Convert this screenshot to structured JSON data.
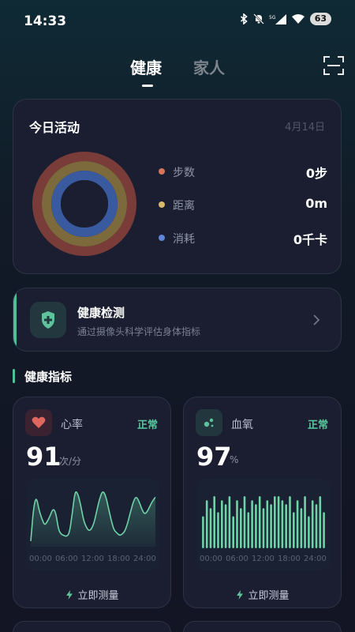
{
  "status_bar": {
    "time": "14:33",
    "battery": "63",
    "network_label": "5G"
  },
  "tabs": [
    {
      "label": "健康",
      "active": true
    },
    {
      "label": "家人",
      "active": false
    }
  ],
  "activity": {
    "title": "今日活动",
    "date": "4月14日",
    "metrics": [
      {
        "label": "步数",
        "value": "0步",
        "color": "#d9745a"
      },
      {
        "label": "距离",
        "value": "0m",
        "color": "#d9b86b"
      },
      {
        "label": "消耗",
        "value": "0千卡",
        "color": "#5e86d6"
      }
    ],
    "ring_colors": [
      "#7a3c38",
      "#7c6a3d",
      "#3a5aa0"
    ],
    "progress": [
      0,
      0,
      0
    ]
  },
  "detect": {
    "title": "健康检测",
    "subtitle": "通过摄像头科学评估身体指标"
  },
  "section": {
    "title": "健康指标"
  },
  "heart_rate": {
    "label": "心率",
    "status": "正常",
    "value": "91",
    "unit": "次/分",
    "measure": "立即测量",
    "axis": [
      "00:00",
      "06:00",
      "12:00",
      "18:00",
      "24:00"
    ],
    "series": [
      60,
      120,
      140,
      115,
      100,
      88,
      95,
      105,
      118,
      112,
      80,
      72,
      70,
      68,
      75,
      110,
      150,
      145,
      125,
      98,
      85,
      78,
      82,
      95,
      118,
      138,
      150,
      142,
      120,
      98,
      80,
      75,
      70,
      72,
      78,
      92,
      112,
      130,
      140,
      132,
      118,
      108,
      112,
      122,
      132,
      138
    ],
    "accent": "#e0675f"
  },
  "spo2": {
    "label": "血氧",
    "status": "正常",
    "value": "97",
    "unit": "%",
    "measure": "立即测量",
    "axis": [
      "00:00",
      "06:00",
      "12:00",
      "18:00",
      "24:00"
    ],
    "bars": [
      93,
      97,
      95,
      98,
      94,
      97,
      96,
      98,
      93,
      97,
      95,
      98,
      94,
      97,
      96,
      98,
      95,
      97,
      96,
      98,
      98,
      97,
      96,
      98,
      94,
      97,
      95,
      98,
      93,
      97,
      96,
      98,
      94
    ],
    "accent": "#5fc29a"
  }
}
